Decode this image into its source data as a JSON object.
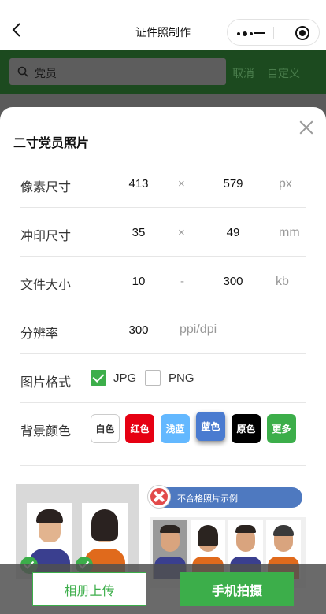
{
  "nav": {
    "title": "证件照制作"
  },
  "search": {
    "query": "党员",
    "cancel": "取消",
    "custom": "自定义"
  },
  "modal": {
    "title": "二寸党员照片",
    "pixel_size": {
      "label": "像素尺寸",
      "width": "413",
      "sep": "×",
      "height": "579",
      "unit": "px"
    },
    "print_size": {
      "label": "冲印尺寸",
      "width": "35",
      "sep": "×",
      "height": "49",
      "unit": "mm"
    },
    "file_size": {
      "label": "文件大小",
      "min": "10",
      "sep": "-",
      "max": "300",
      "unit": "kb"
    },
    "resolution": {
      "label": "分辨率",
      "value": "300",
      "unit": "ppi/dpi"
    },
    "format": {
      "label": "图片格式",
      "options": [
        {
          "name": "JPG",
          "checked": true
        },
        {
          "name": "PNG",
          "checked": false
        }
      ]
    },
    "background": {
      "label": "背景颜色",
      "options": [
        {
          "name": "白色",
          "color": "#ffffff",
          "selected": false
        },
        {
          "name": "红色",
          "color": "#e60012",
          "selected": false
        },
        {
          "name": "浅蓝",
          "color": "#63b8ff",
          "selected": false
        },
        {
          "name": "蓝色",
          "color": "#4a7bd0",
          "selected": true
        },
        {
          "name": "原色",
          "color": "#000000",
          "selected": false
        },
        {
          "name": "更多",
          "color": "#3cae4a",
          "selected": false
        }
      ]
    },
    "bad_example_label": "不合格照片示例"
  },
  "bottom": {
    "album_upload": "相册上传",
    "take_photo": "手机拍摄"
  },
  "colors": {
    "accent": "#3cae4a",
    "banner": "#4e79c0"
  }
}
